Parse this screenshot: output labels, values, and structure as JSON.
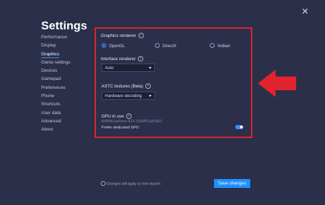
{
  "window": {
    "close_glyph": "✕",
    "title": "Settings"
  },
  "sidebar": {
    "items": [
      {
        "label": "Performance"
      },
      {
        "label": "Display"
      },
      {
        "label": "Graphics",
        "active": true
      },
      {
        "label": "Game settings"
      },
      {
        "label": "Devices"
      },
      {
        "label": "Gamepad"
      },
      {
        "label": "Preferences"
      },
      {
        "label": "Phone"
      },
      {
        "label": "Shortcuts"
      },
      {
        "label": "User data"
      },
      {
        "label": "Advanced"
      },
      {
        "label": "About"
      }
    ]
  },
  "graphics": {
    "renderer_label": "Graphics renderer",
    "renderer_options": [
      "OpenGL",
      "DirectX",
      "Vulkan"
    ],
    "renderer_selected": "OpenGL",
    "interface_label": "Interface renderer",
    "interface_value": "Auto",
    "astc_label": "ASTC textures (Beta)",
    "astc_value": "Hardware decoding",
    "gpu_label": "GPU in use",
    "gpu_value": "NVIDIA GeForce GTX 1650/PCIe/SSE2",
    "prefer_gpu_label": "Prefer dedicated GPU",
    "prefer_gpu_enabled": true,
    "help_glyph": "?"
  },
  "footer": {
    "note": "Changes will apply on next launch",
    "save_label": "Save changes"
  },
  "colors": {
    "accent": "#1e90ff",
    "highlight_box": "#e3232c",
    "background": "#2b2f4a"
  },
  "icons": [
    "close-icon",
    "help-icon",
    "info-icon",
    "dropdown-caret-icon",
    "red-arrow-icon"
  ]
}
